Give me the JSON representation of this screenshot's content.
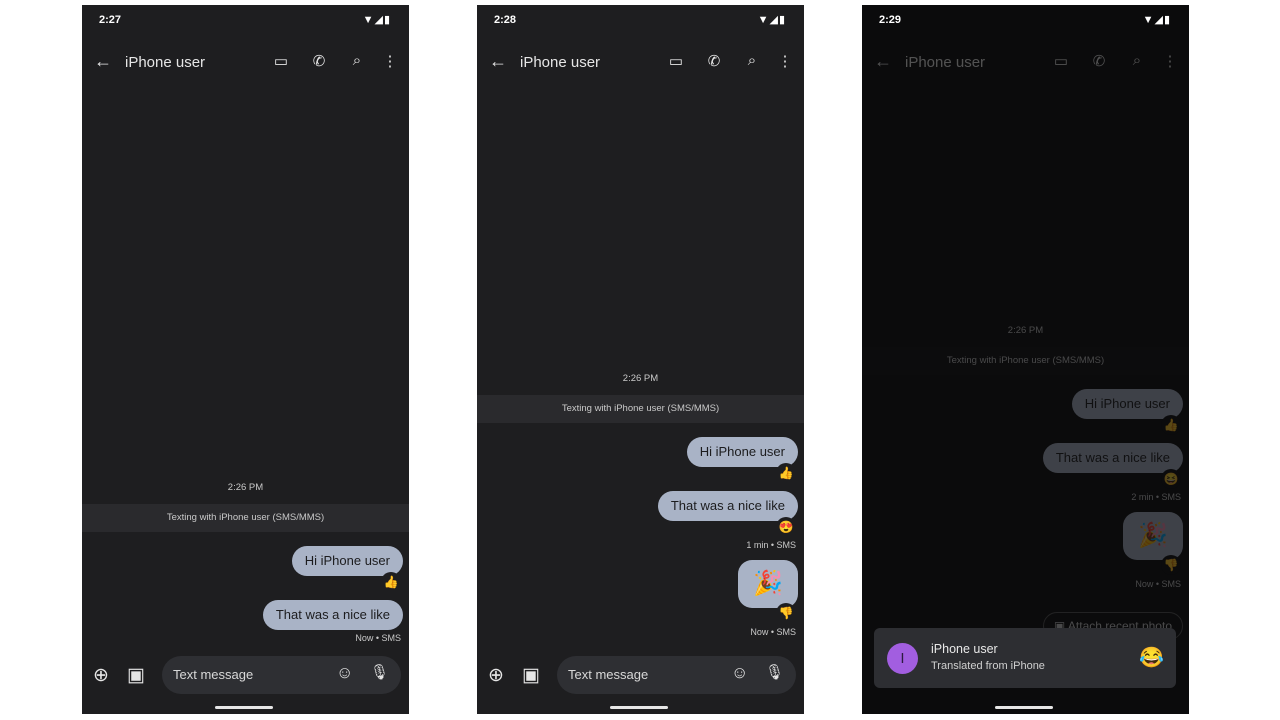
{
  "contact": "iPhone user",
  "banner": "Texting with iPhone user (SMS/MMS)",
  "timestamp": "2:26 PM",
  "placeholder": "Text message",
  "messages": [
    "Hi iPhone user",
    "That was a nice like"
  ],
  "colors": {
    "background": "#1e1e20",
    "bubble": "#a9b3c6",
    "avatar": "#a25ee0"
  },
  "icons": {
    "back": "arrow-left",
    "video": "video-camera",
    "phone": "phone",
    "search": "magnifier",
    "more": "vertical-dots",
    "add": "plus-circle",
    "gallery": "image-camera",
    "emoji": "smiley",
    "mic": "microphone"
  },
  "phones": [
    {
      "time": "2:27",
      "reactions": [
        "👍"
      ],
      "meta": "Now • SMS"
    },
    {
      "time": "2:28",
      "reactions": [
        "👍",
        "😍",
        "👎"
      ],
      "image": "🎉",
      "meta1": "1 min • SMS",
      "meta2": "Now • SMS"
    },
    {
      "time": "2:29",
      "reactions": [
        "👍",
        "😆",
        "👎"
      ],
      "image": "🎉",
      "meta1": "2 min • SMS",
      "meta2": "Now • SMS",
      "chip": "Attach recent photo",
      "notification": {
        "avatar": "I",
        "title": "iPhone user",
        "subtitle": "Translated from iPhone",
        "emoji": "😂"
      }
    }
  ]
}
